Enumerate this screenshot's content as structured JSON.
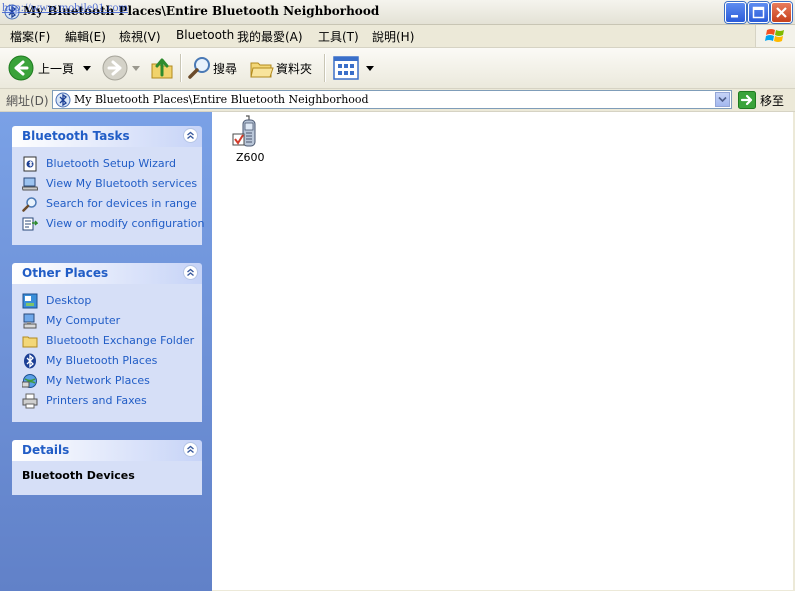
{
  "window": {
    "title": "My Bluetooth Places\\Entire Bluetooth Neighborhood",
    "watermark": "http://www.mobile01.com"
  },
  "menu": [
    {
      "label": "檔案(F)"
    },
    {
      "label": "編輯(E)"
    },
    {
      "label": "檢視(V)"
    },
    {
      "label": "Bluetooth"
    },
    {
      "label": "我的最愛(A)"
    },
    {
      "label": "工具(T)"
    },
    {
      "label": "說明(H)"
    }
  ],
  "toolbar": {
    "back_label": "上一頁",
    "search_label": "搜尋",
    "folders_label": "資料夾"
  },
  "address": {
    "label": "網址(D)",
    "value": "My Bluetooth Places\\Entire Bluetooth Neighborhood",
    "go_label": "移至"
  },
  "task_panels": {
    "bluetooth_tasks": {
      "title": "Bluetooth Tasks",
      "items": [
        {
          "label": "Bluetooth Setup Wizard",
          "icon": "wizard-icon"
        },
        {
          "label": "View My Bluetooth services",
          "icon": "computer-services-icon"
        },
        {
          "label": "Search for devices in range",
          "icon": "magnifier-icon"
        },
        {
          "label": "View or modify configuration",
          "icon": "configuration-icon"
        }
      ]
    },
    "other_places": {
      "title": "Other Places",
      "items": [
        {
          "label": "Desktop",
          "icon": "desktop-icon"
        },
        {
          "label": "My Computer",
          "icon": "my-computer-icon"
        },
        {
          "label": "Bluetooth Exchange Folder",
          "icon": "folder-icon"
        },
        {
          "label": "My Bluetooth Places",
          "icon": "bluetooth-icon"
        },
        {
          "label": "My Network Places",
          "icon": "network-icon"
        },
        {
          "label": "Printers and Faxes",
          "icon": "printer-icon"
        }
      ]
    },
    "details": {
      "title": "Details",
      "value": "Bluetooth Devices"
    }
  },
  "content": {
    "devices": [
      {
        "label": "Z600",
        "icon": "mobile-phone-icon",
        "checked": true
      }
    ]
  },
  "colors": {
    "task_pane": "#7aa1e6",
    "panel_body": "#d6dff7",
    "link": "#215dc6"
  }
}
